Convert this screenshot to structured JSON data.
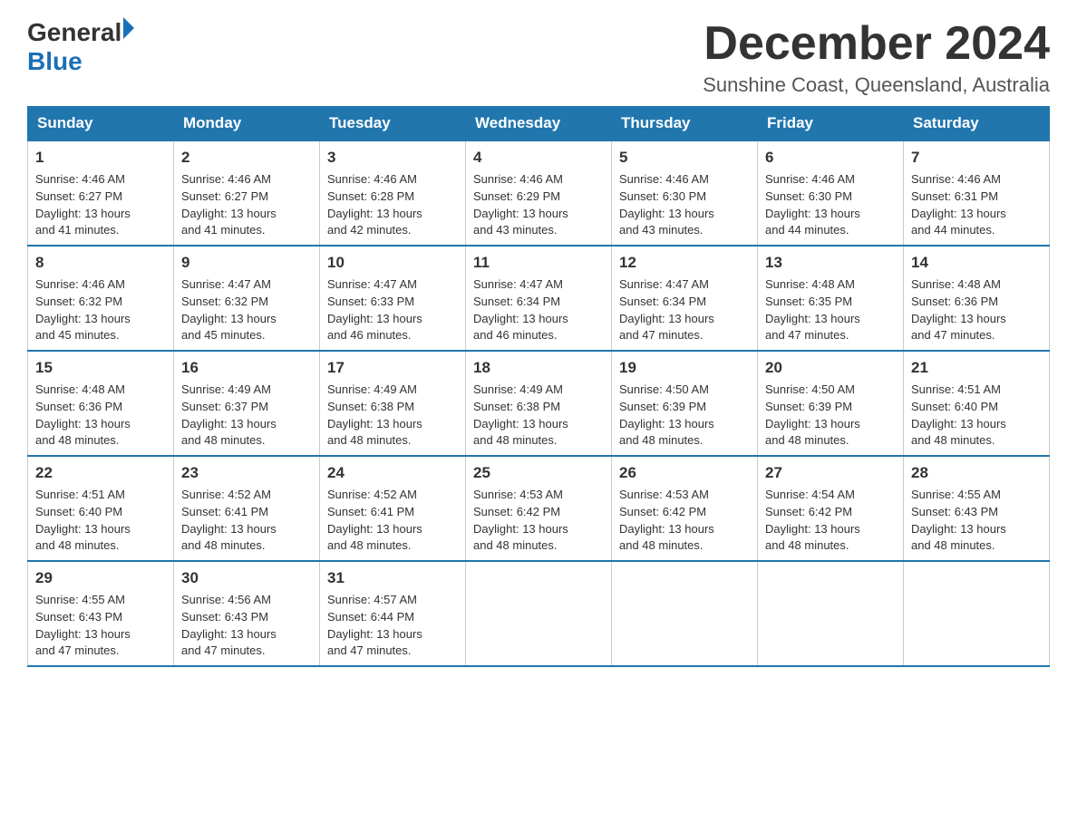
{
  "logo": {
    "general": "General",
    "blue": "Blue"
  },
  "title": "December 2024",
  "location": "Sunshine Coast, Queensland, Australia",
  "days_of_week": [
    "Sunday",
    "Monday",
    "Tuesday",
    "Wednesday",
    "Thursday",
    "Friday",
    "Saturday"
  ],
  "weeks": [
    [
      {
        "day": "1",
        "sunrise": "4:46 AM",
        "sunset": "6:27 PM",
        "daylight": "13 hours and 41 minutes."
      },
      {
        "day": "2",
        "sunrise": "4:46 AM",
        "sunset": "6:27 PM",
        "daylight": "13 hours and 41 minutes."
      },
      {
        "day": "3",
        "sunrise": "4:46 AM",
        "sunset": "6:28 PM",
        "daylight": "13 hours and 42 minutes."
      },
      {
        "day": "4",
        "sunrise": "4:46 AM",
        "sunset": "6:29 PM",
        "daylight": "13 hours and 43 minutes."
      },
      {
        "day": "5",
        "sunrise": "4:46 AM",
        "sunset": "6:30 PM",
        "daylight": "13 hours and 43 minutes."
      },
      {
        "day": "6",
        "sunrise": "4:46 AM",
        "sunset": "6:30 PM",
        "daylight": "13 hours and 44 minutes."
      },
      {
        "day": "7",
        "sunrise": "4:46 AM",
        "sunset": "6:31 PM",
        "daylight": "13 hours and 44 minutes."
      }
    ],
    [
      {
        "day": "8",
        "sunrise": "4:46 AM",
        "sunset": "6:32 PM",
        "daylight": "13 hours and 45 minutes."
      },
      {
        "day": "9",
        "sunrise": "4:47 AM",
        "sunset": "6:32 PM",
        "daylight": "13 hours and 45 minutes."
      },
      {
        "day": "10",
        "sunrise": "4:47 AM",
        "sunset": "6:33 PM",
        "daylight": "13 hours and 46 minutes."
      },
      {
        "day": "11",
        "sunrise": "4:47 AM",
        "sunset": "6:34 PM",
        "daylight": "13 hours and 46 minutes."
      },
      {
        "day": "12",
        "sunrise": "4:47 AM",
        "sunset": "6:34 PM",
        "daylight": "13 hours and 47 minutes."
      },
      {
        "day": "13",
        "sunrise": "4:48 AM",
        "sunset": "6:35 PM",
        "daylight": "13 hours and 47 minutes."
      },
      {
        "day": "14",
        "sunrise": "4:48 AM",
        "sunset": "6:36 PM",
        "daylight": "13 hours and 47 minutes."
      }
    ],
    [
      {
        "day": "15",
        "sunrise": "4:48 AM",
        "sunset": "6:36 PM",
        "daylight": "13 hours and 48 minutes."
      },
      {
        "day": "16",
        "sunrise": "4:49 AM",
        "sunset": "6:37 PM",
        "daylight": "13 hours and 48 minutes."
      },
      {
        "day": "17",
        "sunrise": "4:49 AM",
        "sunset": "6:38 PM",
        "daylight": "13 hours and 48 minutes."
      },
      {
        "day": "18",
        "sunrise": "4:49 AM",
        "sunset": "6:38 PM",
        "daylight": "13 hours and 48 minutes."
      },
      {
        "day": "19",
        "sunrise": "4:50 AM",
        "sunset": "6:39 PM",
        "daylight": "13 hours and 48 minutes."
      },
      {
        "day": "20",
        "sunrise": "4:50 AM",
        "sunset": "6:39 PM",
        "daylight": "13 hours and 48 minutes."
      },
      {
        "day": "21",
        "sunrise": "4:51 AM",
        "sunset": "6:40 PM",
        "daylight": "13 hours and 48 minutes."
      }
    ],
    [
      {
        "day": "22",
        "sunrise": "4:51 AM",
        "sunset": "6:40 PM",
        "daylight": "13 hours and 48 minutes."
      },
      {
        "day": "23",
        "sunrise": "4:52 AM",
        "sunset": "6:41 PM",
        "daylight": "13 hours and 48 minutes."
      },
      {
        "day": "24",
        "sunrise": "4:52 AM",
        "sunset": "6:41 PM",
        "daylight": "13 hours and 48 minutes."
      },
      {
        "day": "25",
        "sunrise": "4:53 AM",
        "sunset": "6:42 PM",
        "daylight": "13 hours and 48 minutes."
      },
      {
        "day": "26",
        "sunrise": "4:53 AM",
        "sunset": "6:42 PM",
        "daylight": "13 hours and 48 minutes."
      },
      {
        "day": "27",
        "sunrise": "4:54 AM",
        "sunset": "6:42 PM",
        "daylight": "13 hours and 48 minutes."
      },
      {
        "day": "28",
        "sunrise": "4:55 AM",
        "sunset": "6:43 PM",
        "daylight": "13 hours and 48 minutes."
      }
    ],
    [
      {
        "day": "29",
        "sunrise": "4:55 AM",
        "sunset": "6:43 PM",
        "daylight": "13 hours and 47 minutes."
      },
      {
        "day": "30",
        "sunrise": "4:56 AM",
        "sunset": "6:43 PM",
        "daylight": "13 hours and 47 minutes."
      },
      {
        "day": "31",
        "sunrise": "4:57 AM",
        "sunset": "6:44 PM",
        "daylight": "13 hours and 47 minutes."
      },
      null,
      null,
      null,
      null
    ]
  ],
  "labels": {
    "sunrise": "Sunrise:",
    "sunset": "Sunset:",
    "daylight": "Daylight:"
  }
}
